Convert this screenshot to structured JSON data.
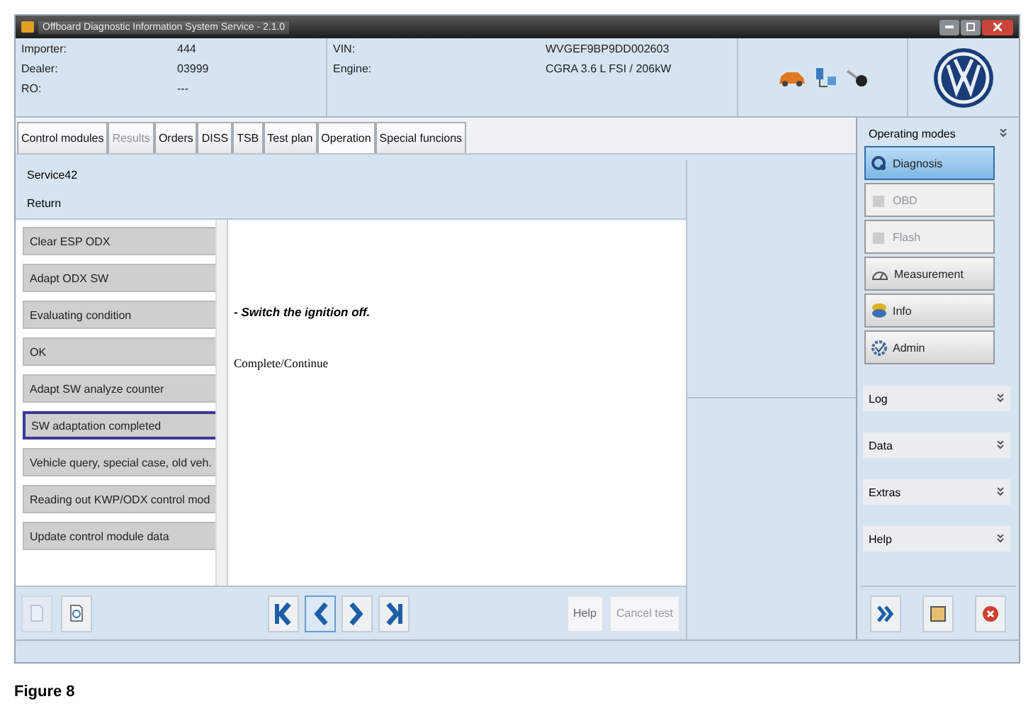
{
  "window": {
    "title": "Offboard Diagnostic Information System Service - 2.1.0"
  },
  "header": {
    "fields": [
      {
        "label": "Importer:",
        "value": "444"
      },
      {
        "label": "Dealer:",
        "value": "03999"
      },
      {
        "label": "RO:",
        "value": "---"
      }
    ],
    "vehicle": [
      {
        "label": "VIN:",
        "value": "WVGEF9BP9DD002603"
      },
      {
        "label": "Engine:",
        "value": "CGRA 3.6 L FSI / 206kW"
      }
    ]
  },
  "tabs": [
    {
      "label": "Control modules",
      "selected": false,
      "disabled": false
    },
    {
      "label": "Results",
      "selected": false,
      "disabled": true
    },
    {
      "label": "Orders",
      "selected": false,
      "disabled": false
    },
    {
      "label": "DISS",
      "selected": false,
      "disabled": false
    },
    {
      "label": "TSB",
      "selected": false,
      "disabled": false
    },
    {
      "label": "Test plan",
      "selected": false,
      "disabled": false
    },
    {
      "label": "Operation",
      "selected": true,
      "disabled": false
    },
    {
      "label": "Special funcions",
      "selected": false,
      "disabled": false
    }
  ],
  "breadcrumb": [
    "Service42",
    "Return"
  ],
  "steps": [
    {
      "label": "Clear ESP ODX",
      "selected": false
    },
    {
      "label": "Adapt ODX SW",
      "selected": false
    },
    {
      "label": "Evaluating condition",
      "selected": false
    },
    {
      "label": "OK",
      "selected": false
    },
    {
      "label": "Adapt SW analyze counter",
      "selected": false
    },
    {
      "label": "SW adaptation completed",
      "selected": true
    },
    {
      "label": "Vehicle query, special case, old veh.",
      "selected": false
    },
    {
      "label": "Reading out KWP/ODX control mod",
      "selected": false
    },
    {
      "label": "Update control module data",
      "selected": false
    }
  ],
  "content": {
    "instruction": "- Switch the ignition off.",
    "action": "Complete/Continue"
  },
  "bottom_buttons": [
    {
      "label": "Help",
      "disabled": false
    },
    {
      "label": "Cancel test",
      "disabled": true
    }
  ],
  "sidebar": {
    "title": "Operating modes",
    "modes": [
      {
        "label": "Diagnosis",
        "kind": "diagnosis",
        "selected": true,
        "disabled": false
      },
      {
        "label": "OBD",
        "kind": "obd",
        "selected": false,
        "disabled": true
      },
      {
        "label": "Flash",
        "kind": "flash",
        "selected": false,
        "disabled": true
      },
      {
        "label": "Measurement",
        "kind": "measurement",
        "selected": false,
        "disabled": false
      },
      {
        "label": "Info",
        "kind": "info",
        "selected": false,
        "disabled": false
      },
      {
        "label": "Admin",
        "kind": "admin",
        "selected": false,
        "disabled": false
      }
    ],
    "sections": [
      "Log",
      "Data",
      "Extras",
      "Help"
    ]
  },
  "caption": "Figure 8"
}
